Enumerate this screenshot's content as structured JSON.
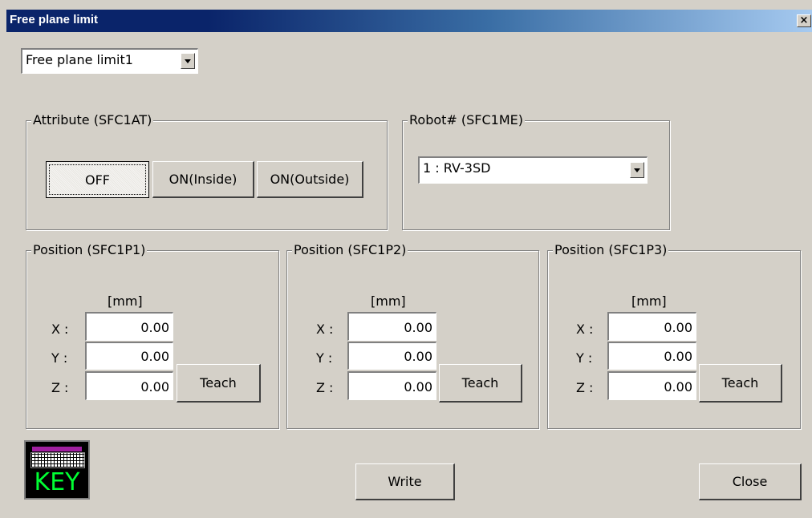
{
  "window": {
    "title": "Free plane limit",
    "close_glyph": "×"
  },
  "plane_select": {
    "value": "Free plane limit1"
  },
  "attribute": {
    "legend": "Attribute (SFC1AT)",
    "buttons": [
      "OFF",
      "ON(Inside)",
      "ON(Outside)"
    ],
    "selected": "OFF"
  },
  "robot": {
    "legend": "Robot# (SFC1ME)",
    "value": "1 : RV-3SD"
  },
  "positions": [
    {
      "legend": "Position (SFC1P1)",
      "unit": "[mm]",
      "x_label": "X :",
      "y_label": "Y :",
      "z_label": "Z :",
      "x": "0.00",
      "y": "0.00",
      "z": "0.00",
      "teach": "Teach"
    },
    {
      "legend": "Position (SFC1P2)",
      "unit": "[mm]",
      "x_label": "X :",
      "y_label": "Y :",
      "z_label": "Z :",
      "x": "0.00",
      "y": "0.00",
      "z": "0.00",
      "teach": "Teach"
    },
    {
      "legend": "Position (SFC1P3)",
      "unit": "[mm]",
      "x_label": "X :",
      "y_label": "Y :",
      "z_label": "Z :",
      "x": "0.00",
      "y": "0.00",
      "z": "0.00",
      "teach": "Teach"
    }
  ],
  "footer": {
    "key_label": "KEY",
    "write": "Write",
    "close": "Close"
  },
  "colors": {
    "title_bar_start": "#0a246a",
    "title_bar_end": "#a6caf0",
    "dialog_bg": "#d4d0c8",
    "key_text": "#00ff33"
  }
}
